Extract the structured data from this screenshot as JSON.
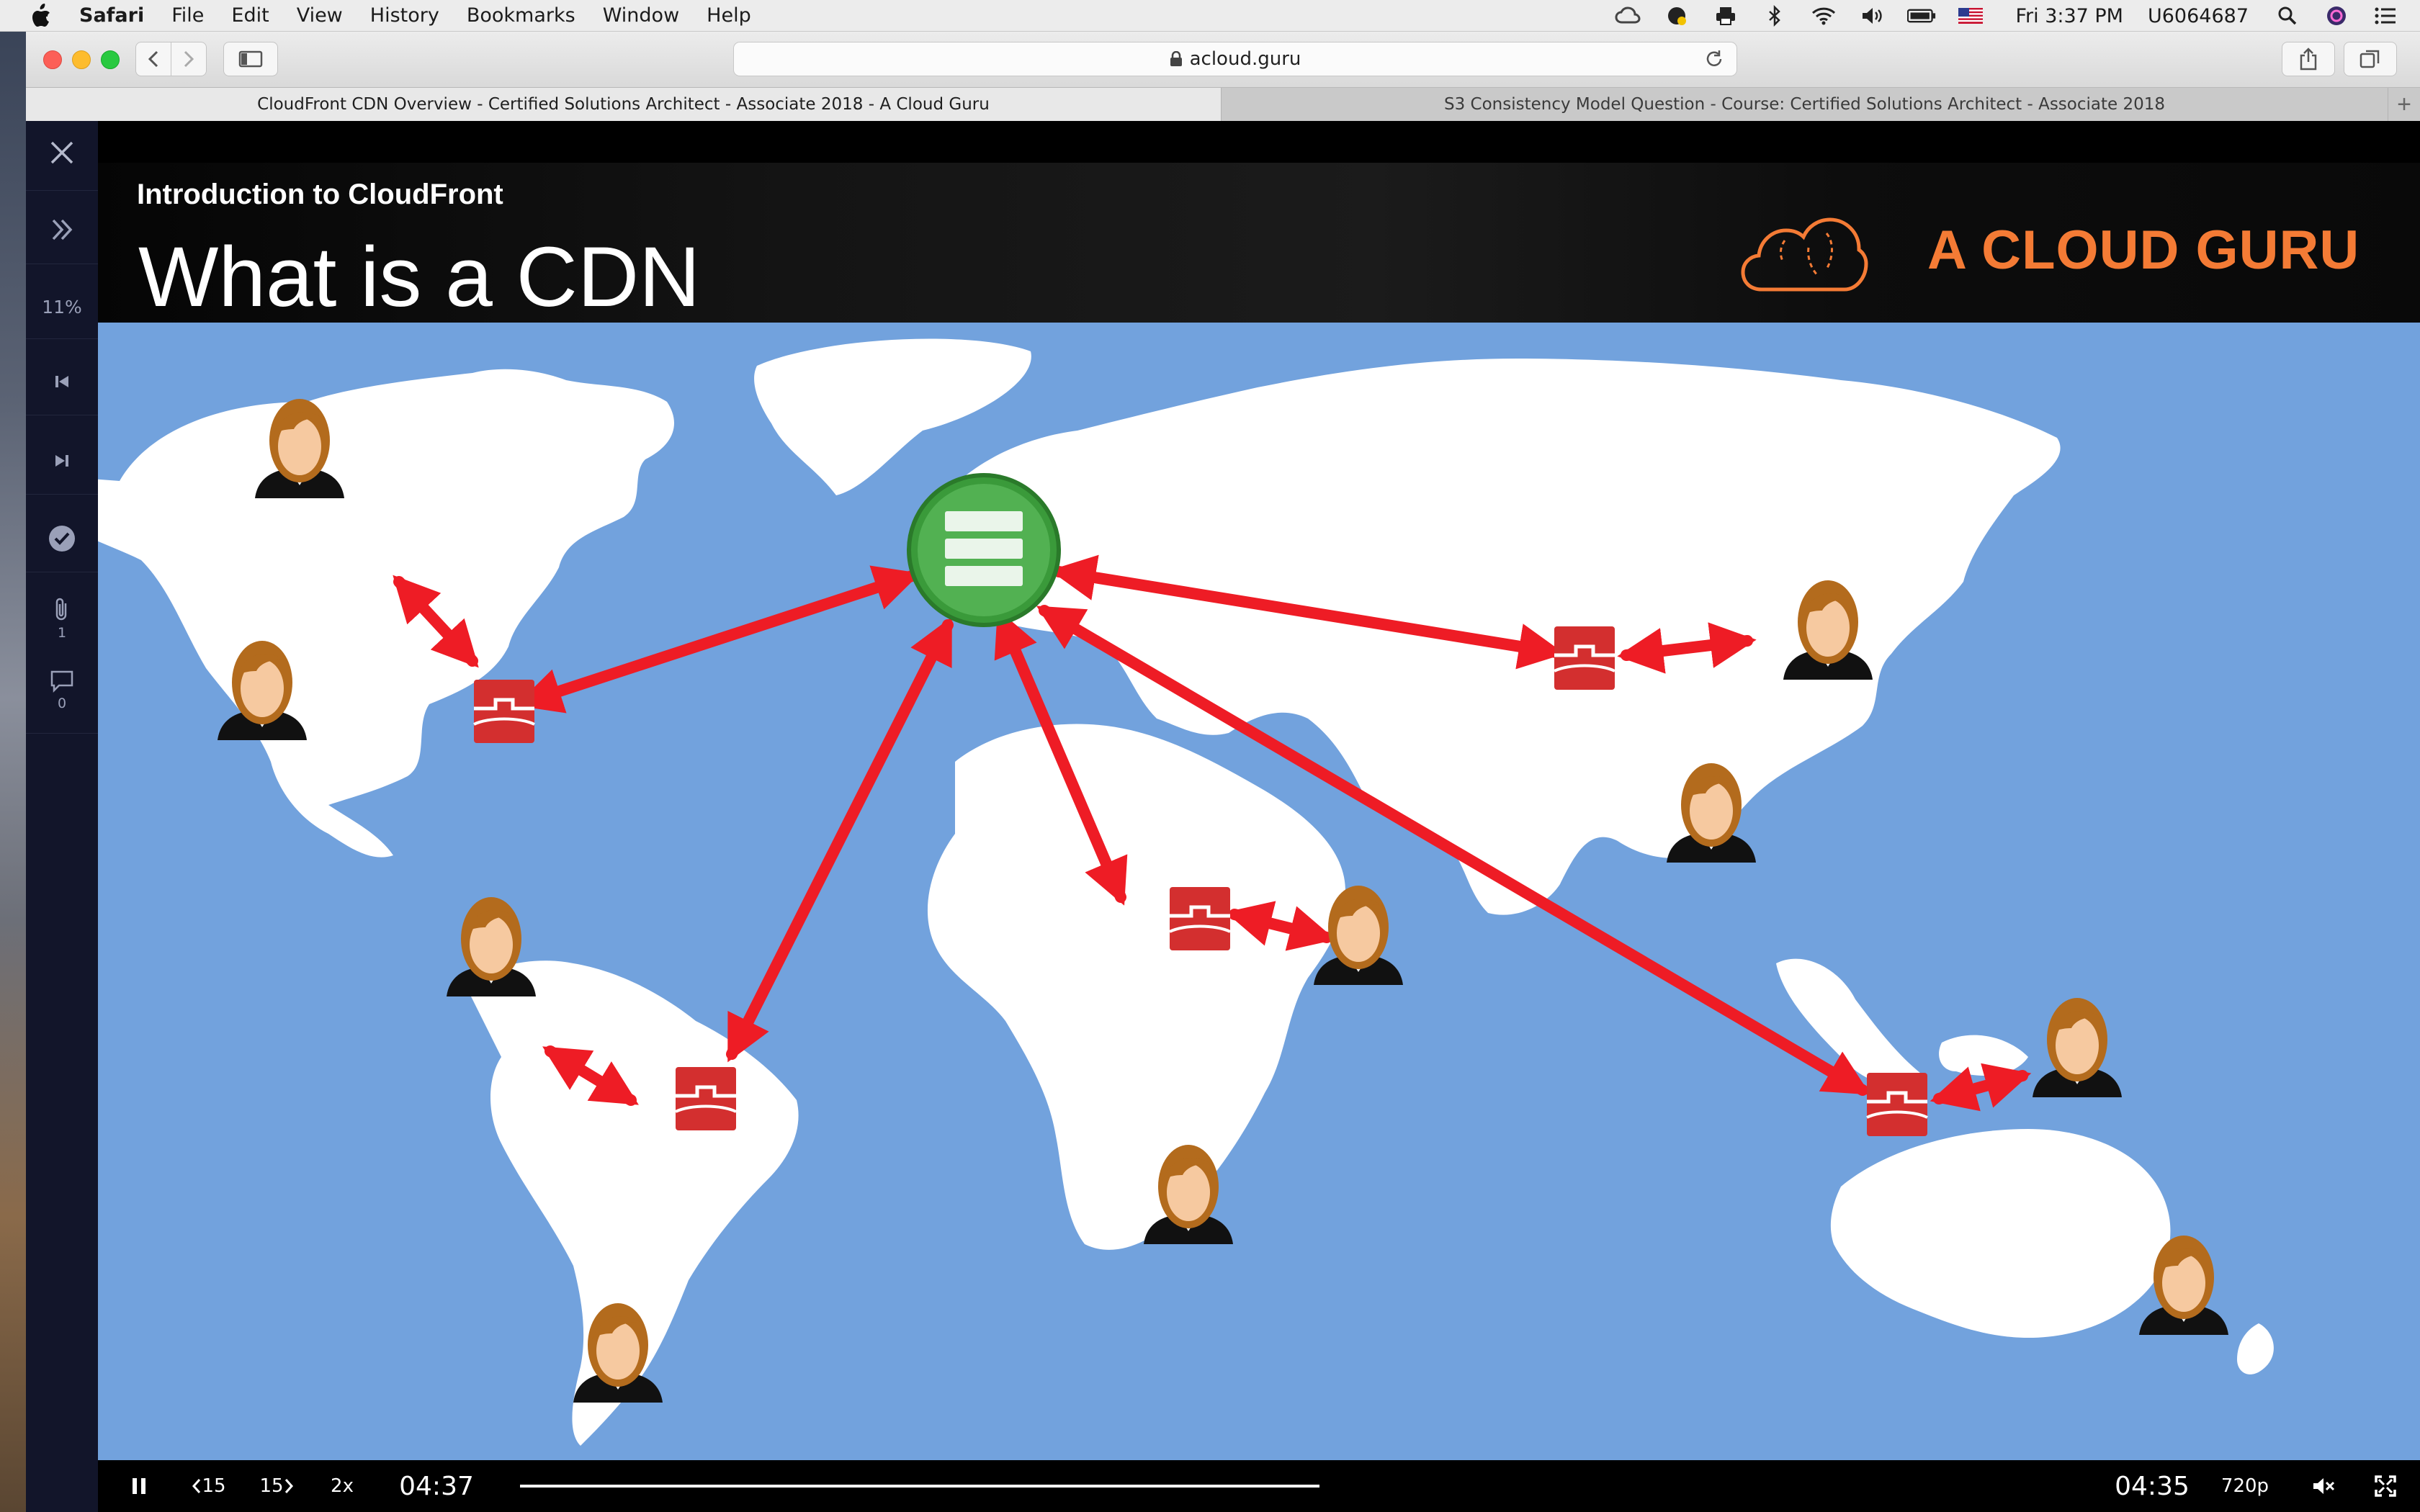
{
  "menubar": {
    "app_name": "Safari",
    "items": [
      "File",
      "Edit",
      "View",
      "History",
      "Bookmarks",
      "Window",
      "Help"
    ],
    "clock": "Fri 3:37 PM",
    "user": "U6064687"
  },
  "browser": {
    "url": "acloud.guru",
    "tabs": [
      {
        "label": "CloudFront CDN Overview - Certified Solutions Architect - Associate 2018 - A Cloud Guru",
        "active": true
      },
      {
        "label": "S3 Consistency Model Question - Course: Certified Solutions Architect - Associate 2018",
        "active": false
      }
    ],
    "new_tab_glyph": "+"
  },
  "sidebar": {
    "progress": "11%",
    "attachments_count": "1",
    "comments_count": "0",
    "icons": [
      "close-icon",
      "expand-chevrons-icon",
      "skip-previous-icon",
      "skip-next-icon",
      "complete-check-icon",
      "paperclip-icon",
      "comment-icon"
    ]
  },
  "slide": {
    "subtitle": "Introduction to CloudFront",
    "title": "What is a CDN",
    "brand": "A CLOUD GURU",
    "colors": {
      "ocean": "#72a2dd",
      "land": "#ffffff",
      "arrows": "#ee1c25",
      "origin_server": "#3a9a3a",
      "edge_location": "#d32f2f",
      "brand": "#f47b35"
    }
  },
  "player": {
    "rewind_label": "15",
    "forward_label": "15",
    "speed": "2x",
    "elapsed": "04:37",
    "remaining": "04:35",
    "quality": "720p",
    "progress": 1.0
  }
}
